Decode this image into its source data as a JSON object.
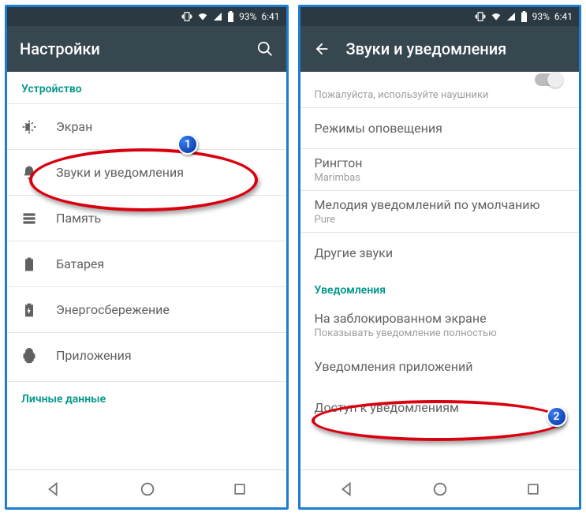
{
  "status": {
    "battery": "93%",
    "time": "6:41"
  },
  "left": {
    "title": "Настройки",
    "section_device": "Устройство",
    "section_personal": "Личные данные",
    "items": [
      {
        "label": "Экран"
      },
      {
        "label": "Звуки и уведомления"
      },
      {
        "label": "Память"
      },
      {
        "label": "Батарея"
      },
      {
        "label": "Энергосбережение"
      },
      {
        "label": "Приложения"
      }
    ],
    "badge": "1"
  },
  "right": {
    "title": "Звуки и уведомления",
    "hint": "Пожалуйста, используйте наушники",
    "items": [
      {
        "label": "Режимы оповещения"
      },
      {
        "label": "Рингтон",
        "sub": "Marimbas"
      },
      {
        "label": "Мелодия уведомлений по умолчанию",
        "sub": "Pure"
      },
      {
        "label": "Другие звуки"
      }
    ],
    "section_notif": "Уведомления",
    "items2": [
      {
        "label": "На заблокированном экране",
        "sub": "Показывать уведомление полностью"
      },
      {
        "label": "Уведомления приложений"
      },
      {
        "label": "Доступ к уведомлениям"
      }
    ],
    "badge": "2"
  }
}
